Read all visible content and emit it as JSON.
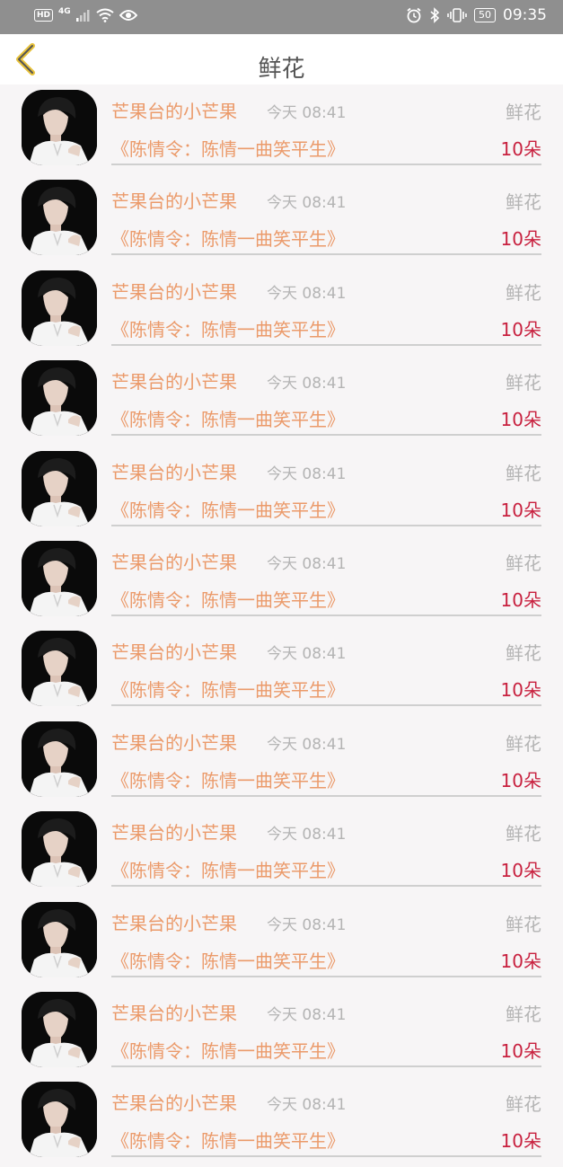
{
  "status_bar": {
    "badge": "HD",
    "network": "4G",
    "battery": "50",
    "time": "09:35"
  },
  "header": {
    "title": "鲜花"
  },
  "items": [
    {
      "user": "芒果台的小芒果",
      "time": "今天 08:41",
      "type": "鲜花",
      "title": "《陈情令：陈情一曲笑平生》",
      "count": "10朵"
    },
    {
      "user": "芒果台的小芒果",
      "time": "今天 08:41",
      "type": "鲜花",
      "title": "《陈情令：陈情一曲笑平生》",
      "count": "10朵"
    },
    {
      "user": "芒果台的小芒果",
      "time": "今天 08:41",
      "type": "鲜花",
      "title": "《陈情令：陈情一曲笑平生》",
      "count": "10朵"
    },
    {
      "user": "芒果台的小芒果",
      "time": "今天 08:41",
      "type": "鲜花",
      "title": "《陈情令：陈情一曲笑平生》",
      "count": "10朵"
    },
    {
      "user": "芒果台的小芒果",
      "time": "今天 08:41",
      "type": "鲜花",
      "title": "《陈情令：陈情一曲笑平生》",
      "count": "10朵"
    },
    {
      "user": "芒果台的小芒果",
      "time": "今天 08:41",
      "type": "鲜花",
      "title": "《陈情令：陈情一曲笑平生》",
      "count": "10朵"
    },
    {
      "user": "芒果台的小芒果",
      "time": "今天 08:41",
      "type": "鲜花",
      "title": "《陈情令：陈情一曲笑平生》",
      "count": "10朵"
    },
    {
      "user": "芒果台的小芒果",
      "time": "今天 08:41",
      "type": "鲜花",
      "title": "《陈情令：陈情一曲笑平生》",
      "count": "10朵"
    },
    {
      "user": "芒果台的小芒果",
      "time": "今天 08:41",
      "type": "鲜花",
      "title": "《陈情令：陈情一曲笑平生》",
      "count": "10朵"
    },
    {
      "user": "芒果台的小芒果",
      "time": "今天 08:41",
      "type": "鲜花",
      "title": "《陈情令：陈情一曲笑平生》",
      "count": "10朵"
    },
    {
      "user": "芒果台的小芒果",
      "time": "今天 08:41",
      "type": "鲜花",
      "title": "《陈情令：陈情一曲笑平生》",
      "count": "10朵"
    },
    {
      "user": "芒果台的小芒果",
      "time": "今天 08:41",
      "type": "鲜花",
      "title": "《陈情令：陈情一曲笑平生》",
      "count": "10朵"
    }
  ],
  "colors": {
    "accent_text": "#eb9a6a",
    "count_text": "#c8213f",
    "muted_text": "#b4b4b4",
    "back_arrow": "#e8c23a",
    "status_bar_bg": "#8f8f8f"
  },
  "icons": {
    "back": "chevron-left-icon",
    "avatar": "portrait-photo"
  }
}
